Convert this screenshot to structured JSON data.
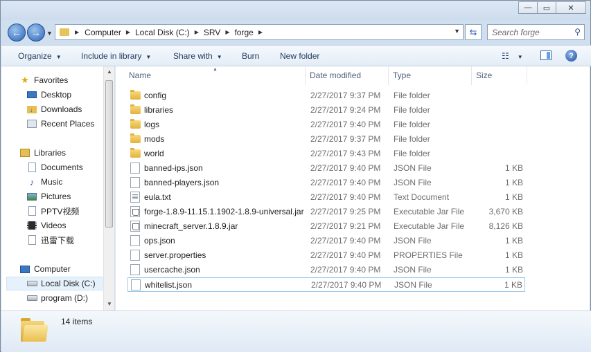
{
  "window": {
    "buttons": {
      "minimize": "—",
      "maximize": "▭",
      "close": "✕"
    }
  },
  "address": {
    "crumbs": [
      "Computer",
      "Local Disk (C:)",
      "SRV",
      "forge"
    ],
    "search_placeholder": "Search forge"
  },
  "toolbar": {
    "organize": "Organize",
    "include_in_library": "Include in library",
    "share_with": "Share with",
    "burn": "Burn",
    "new_folder": "New folder"
  },
  "nav": {
    "favorites": {
      "label": "Favorites",
      "icon": "star-icon"
    },
    "favorites_items": [
      {
        "label": "Desktop",
        "icon": "desktop-icon"
      },
      {
        "label": "Downloads",
        "icon": "downloads-icon"
      },
      {
        "label": "Recent Places",
        "icon": "recent-places-icon"
      }
    ],
    "libraries": {
      "label": "Libraries",
      "icon": "libraries-icon"
    },
    "libraries_items": [
      {
        "label": "Documents",
        "icon": "documents-icon"
      },
      {
        "label": "Music",
        "icon": "music-icon"
      },
      {
        "label": "Pictures",
        "icon": "pictures-icon"
      },
      {
        "label": "PPTV视频",
        "icon": "video-library-icon"
      },
      {
        "label": "Videos",
        "icon": "videos-icon"
      },
      {
        "label": "迅雷下载",
        "icon": "download-library-icon"
      }
    ],
    "computer": {
      "label": "Computer",
      "icon": "computer-icon"
    },
    "computer_items": [
      {
        "label": "Local Disk (C:)",
        "icon": "drive-icon",
        "selected": true
      },
      {
        "label": "program (D:)",
        "icon": "drive-icon"
      }
    ]
  },
  "columns": {
    "name": "Name",
    "date": "Date modified",
    "type": "Type",
    "size": "Size"
  },
  "files": [
    {
      "name": "config",
      "date": "2/27/2017 9:37 PM",
      "type": "File folder",
      "size": "",
      "icon": "folder"
    },
    {
      "name": "libraries",
      "date": "2/27/2017 9:24 PM",
      "type": "File folder",
      "size": "",
      "icon": "folder"
    },
    {
      "name": "logs",
      "date": "2/27/2017 9:40 PM",
      "type": "File folder",
      "size": "",
      "icon": "folder"
    },
    {
      "name": "mods",
      "date": "2/27/2017 9:37 PM",
      "type": "File folder",
      "size": "",
      "icon": "folder"
    },
    {
      "name": "world",
      "date": "2/27/2017 9:43 PM",
      "type": "File folder",
      "size": "",
      "icon": "folder"
    },
    {
      "name": "banned-ips.json",
      "date": "2/27/2017 9:40 PM",
      "type": "JSON File",
      "size": "1 KB",
      "icon": "doc"
    },
    {
      "name": "banned-players.json",
      "date": "2/27/2017 9:40 PM",
      "type": "JSON File",
      "size": "1 KB",
      "icon": "doc"
    },
    {
      "name": "eula.txt",
      "date": "2/27/2017 9:40 PM",
      "type": "Text Document",
      "size": "1 KB",
      "icon": "txt"
    },
    {
      "name": "forge-1.8.9-11.15.1.1902-1.8.9-universal.jar",
      "date": "2/27/2017 9:25 PM",
      "type": "Executable Jar File",
      "size": "3,670 KB",
      "icon": "jar"
    },
    {
      "name": "minecraft_server.1.8.9.jar",
      "date": "2/27/2017 9:21 PM",
      "type": "Executable Jar File",
      "size": "8,126 KB",
      "icon": "jar"
    },
    {
      "name": "ops.json",
      "date": "2/27/2017 9:40 PM",
      "type": "JSON File",
      "size": "1 KB",
      "icon": "doc"
    },
    {
      "name": "server.properties",
      "date": "2/27/2017 9:40 PM",
      "type": "PROPERTIES File",
      "size": "1 KB",
      "icon": "doc"
    },
    {
      "name": "usercache.json",
      "date": "2/27/2017 9:40 PM",
      "type": "JSON File",
      "size": "1 KB",
      "icon": "doc"
    },
    {
      "name": "whitelist.json",
      "date": "2/27/2017 9:40 PM",
      "type": "JSON File",
      "size": "1 KB",
      "icon": "doc",
      "selected": true
    }
  ],
  "details": {
    "item_count": "14 items"
  }
}
